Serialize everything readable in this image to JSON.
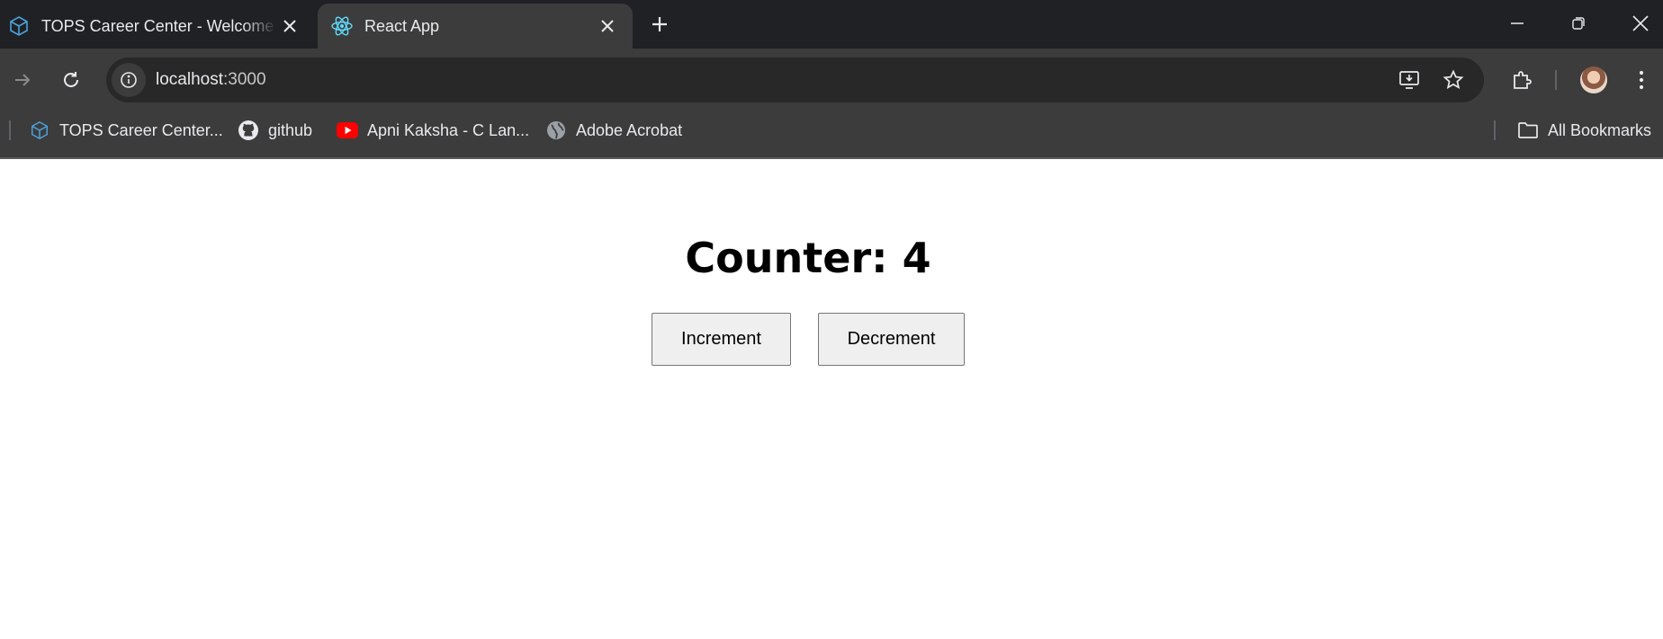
{
  "browser": {
    "tabs": [
      {
        "title": "TOPS Career Center - Welcome",
        "favicon": "tops-cube-icon",
        "active": false
      },
      {
        "title": "React App",
        "favicon": "react-icon",
        "active": true
      }
    ],
    "address": {
      "host": "localhost",
      "port": ":3000"
    },
    "bookmarks": [
      {
        "label": "TOPS Career Center...",
        "icon": "tops-cube-icon"
      },
      {
        "label": "github",
        "icon": "github-icon"
      },
      {
        "label": "Apni Kaksha - C Lan...",
        "icon": "youtube-icon"
      },
      {
        "label": "Adobe Acrobat",
        "icon": "globe-icon"
      }
    ],
    "all_bookmarks": "All Bookmarks",
    "colors": {
      "tabstrip": "#202124",
      "toolbar": "#3c3c3c",
      "omnibox": "#282828",
      "youtube": "#ff0000",
      "react": "#61dafb",
      "tops": "#4aa3df"
    }
  },
  "app": {
    "counter_label": "Counter: 4",
    "increment_label": "Increment",
    "decrement_label": "Decrement"
  }
}
